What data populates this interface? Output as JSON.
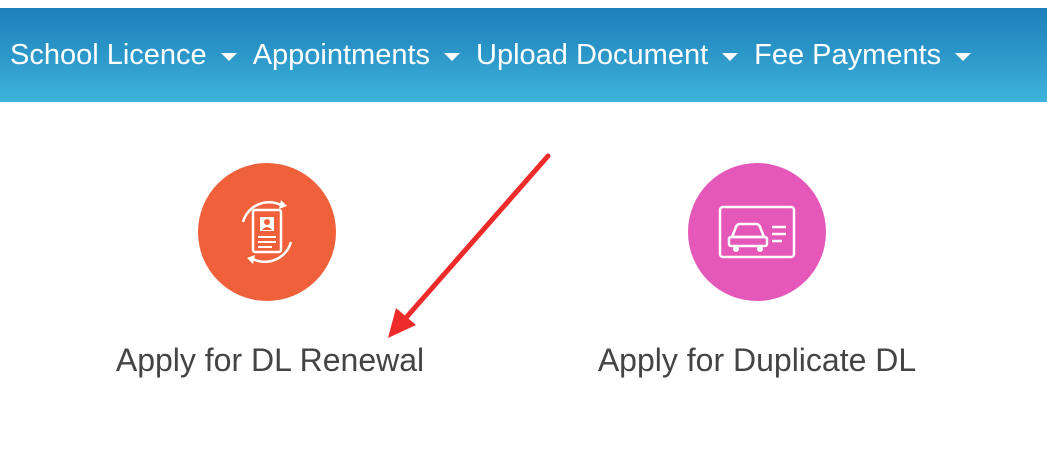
{
  "nav": {
    "items": [
      {
        "label": "School Licence"
      },
      {
        "label": "Appointments"
      },
      {
        "label": "Upload Document"
      },
      {
        "label": "Fee Payments"
      }
    ]
  },
  "services": {
    "renewal": {
      "label": "Apply for DL Renewal",
      "icon": "license-renewal-icon",
      "color": "#f0603a"
    },
    "duplicate": {
      "label": "Apply for Duplicate DL",
      "icon": "car-card-icon",
      "color": "#e557b9"
    }
  },
  "annotation": {
    "arrow_color": "#ee2b2b"
  }
}
